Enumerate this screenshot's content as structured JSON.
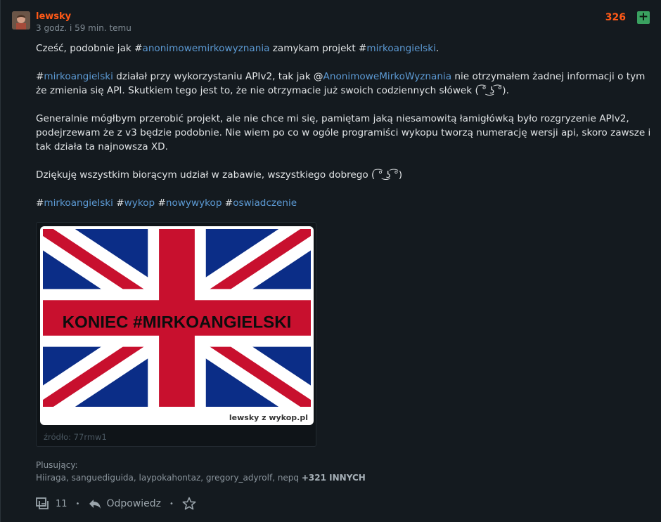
{
  "post": {
    "author": "lewsky",
    "time": "3 godz. i 59 min. temu",
    "score": "326",
    "plus_label": "+",
    "paragraphs": [
      [
        {
          "t": "Cześć, podobnie jak #"
        },
        {
          "t": "anonimowemirkowyznania",
          "k": "tag"
        },
        {
          "t": " zamykam projekt #"
        },
        {
          "t": "mirkoangielski",
          "k": "tag"
        },
        {
          "t": "."
        }
      ],
      [
        {
          "t": "#"
        },
        {
          "t": "mirkoangielski",
          "k": "tag"
        },
        {
          "t": " działał przy wykorzystaniu APIv2, tak jak @"
        },
        {
          "t": "AnonimoweMirkoWyznania",
          "k": "mention"
        },
        {
          "t": " nie otrzymałem żadnej informacji o tym że zmienia się API. Skutkiem tego jest to, że nie otrzymacie już swoich codziennych słówek ( ͡° ͜ʖ ͡°)."
        }
      ],
      [
        {
          "t": "Generalnie mógłbym przerobić projekt, ale nie chce mi się, pamiętam jaką niesamowitą łamigłówką było rozgryzenie APIv2, podejrzewam że z v3 będzie podobnie. Nie wiem po co w ogóle programiści wykopu tworzą numerację wersji api, skoro zawsze i tak działa ta najnowsza XD."
        }
      ],
      [
        {
          "t": "Dziękuję wszystkim biorącym udział w zabawie, wszystkiego dobrego ( ͡° ͜ʖ ͡°)"
        }
      ],
      [
        {
          "t": "#"
        },
        {
          "t": "mirkoangielski",
          "k": "tag"
        },
        {
          "t": " #"
        },
        {
          "t": "wykop",
          "k": "tag"
        },
        {
          "t": " #"
        },
        {
          "t": "nowywykop",
          "k": "tag"
        },
        {
          "t": " #"
        },
        {
          "t": "oswiadczenie",
          "k": "tag"
        }
      ]
    ],
    "image": {
      "banner_text": "KONIEC #MIRKOANGIELSKI",
      "watermark": "lewsky z  wykop.pl"
    },
    "source": "źródło: 77rmw1",
    "voters_label": "Plusujący:",
    "voters": "Hiiraga, sanguediguida, laypokahontaz, gregory_adyrolf, nepq",
    "voters_more": "+321 INNYCH",
    "comments_count": "11",
    "reply_label": "Odpowiedz"
  },
  "colors": {
    "author": "#ff5917",
    "tag": "#5c9ad4",
    "plus": "#3aa160",
    "background": "#141a1f"
  },
  "icons": [
    "comments-icon",
    "reply-icon",
    "star-icon",
    "plus-icon"
  ]
}
